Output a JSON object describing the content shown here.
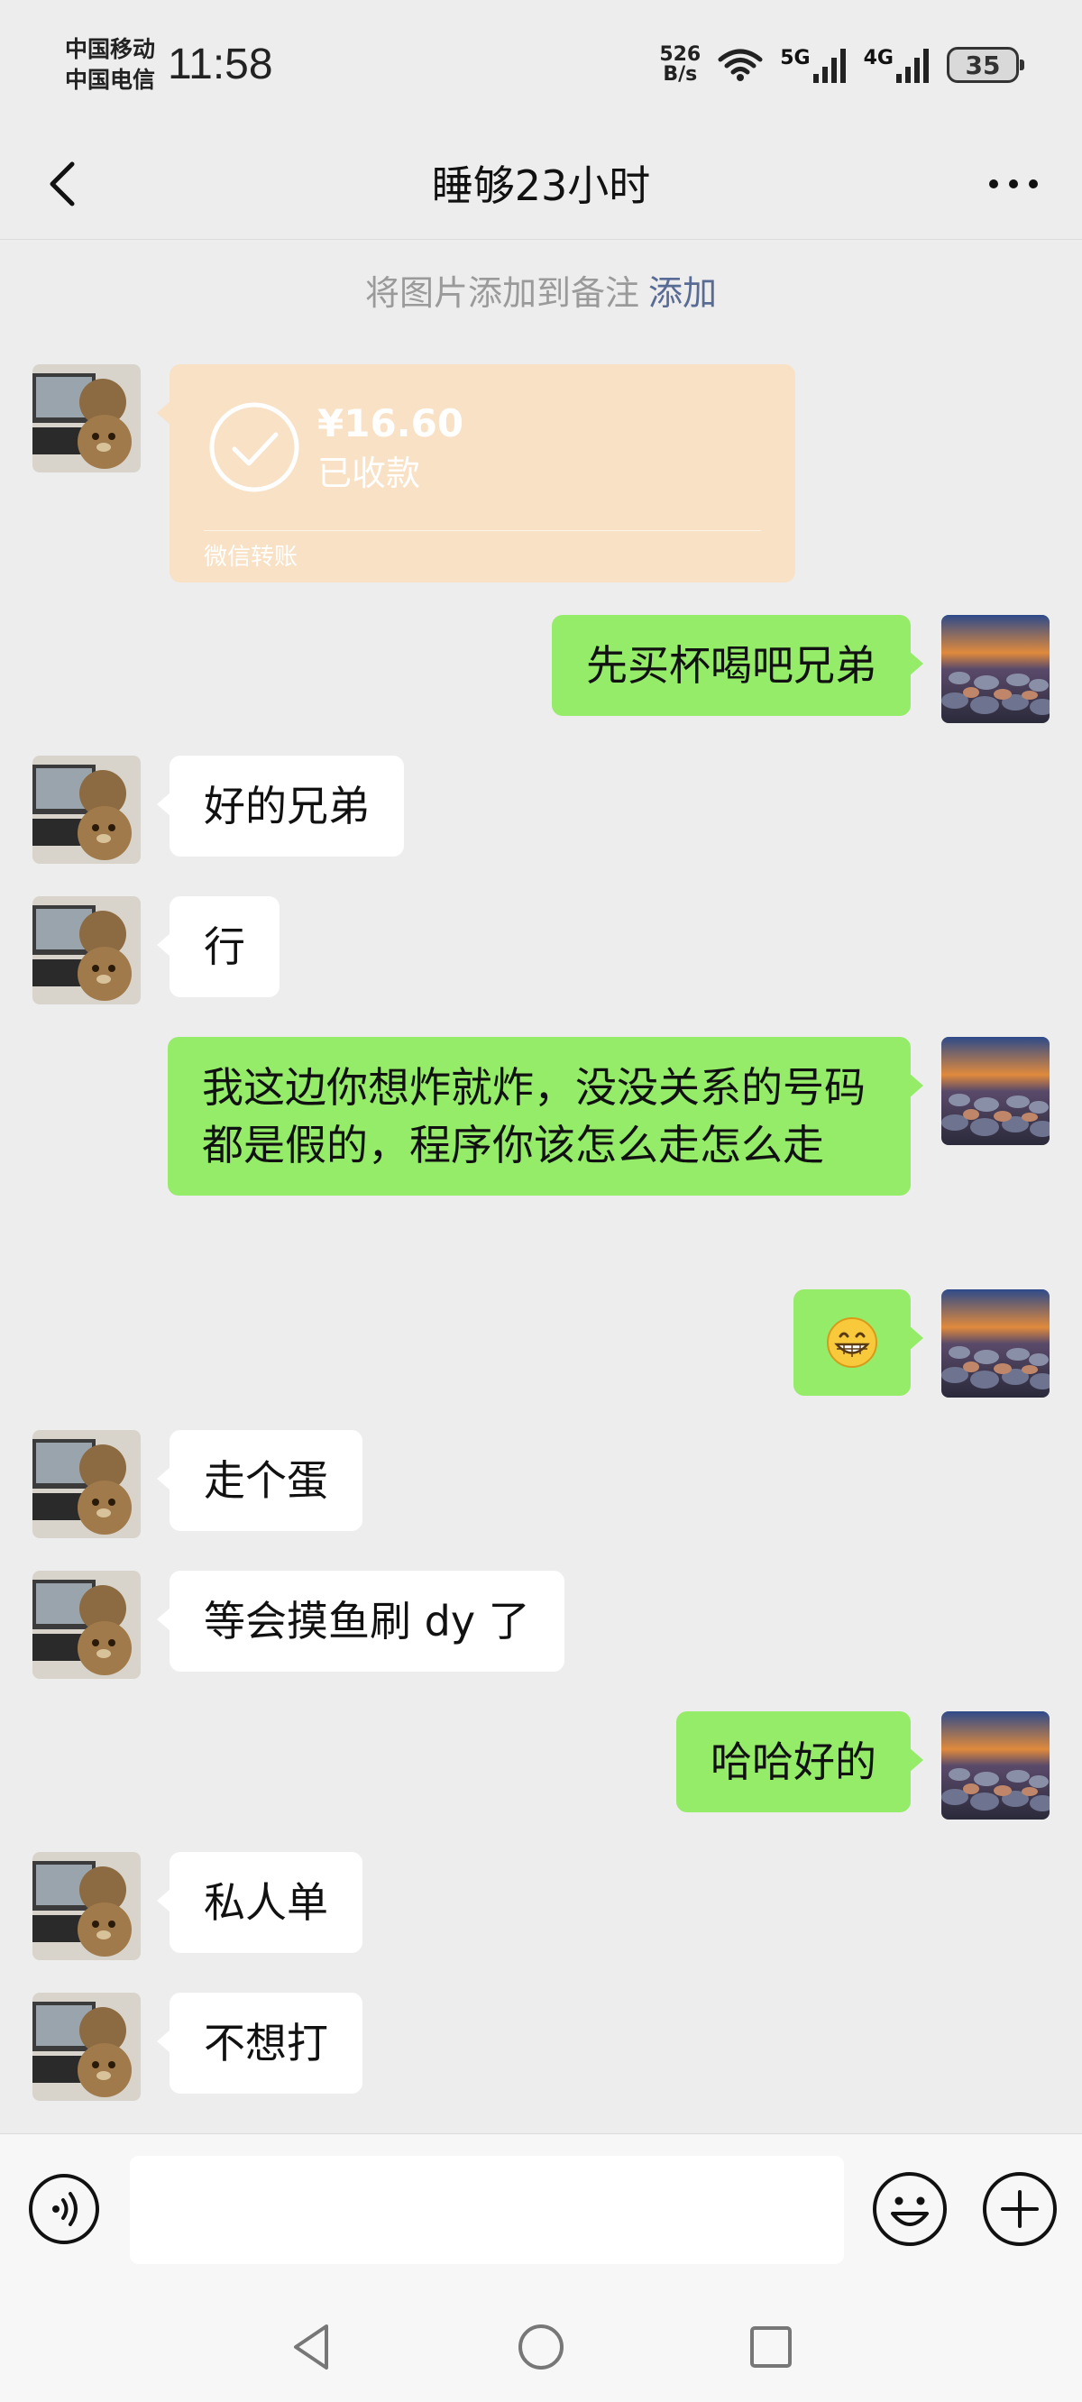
{
  "status_bar": {
    "carrier_1": "中国移动",
    "carrier_2": "中国电信",
    "time": "11:58",
    "net_speed_value": "526",
    "net_speed_unit": "B/s",
    "signal_1": "5G",
    "signal_2": "4G",
    "battery": "35"
  },
  "nav": {
    "title": "睡够23小时",
    "back_icon": "chevron-left-icon",
    "more_icon": "more-dots-icon"
  },
  "notice": {
    "text": "将图片添加到备注",
    "link": "添加"
  },
  "transfer": {
    "amount": "¥16.60",
    "status": "已收款",
    "label": "微信转账"
  },
  "messages": [
    {
      "side": "right",
      "text": "先买杯喝吧兄弟"
    },
    {
      "side": "left",
      "text": "好的兄弟"
    },
    {
      "side": "left",
      "text": "行"
    },
    {
      "side": "right",
      "text": "我这边你想炸就炸，没没关系的号码都是假的，程序你该怎么走怎么走"
    },
    {
      "side": "right",
      "text": "",
      "emoji": "grin-emoji"
    },
    {
      "side": "left",
      "text": "走个蛋"
    },
    {
      "side": "left",
      "text": "等会摸鱼刷 dy 了"
    },
    {
      "side": "right",
      "text": "哈哈好的"
    },
    {
      "side": "left",
      "text": "私人单"
    },
    {
      "side": "left",
      "text": "不想打"
    }
  ],
  "input_bar": {
    "placeholder": "",
    "voice_icon": "voice-icon",
    "emoji_icon": "emoji-icon",
    "plus_icon": "plus-icon"
  },
  "colors": {
    "background": "#ededed",
    "bubble_self": "#95ec69",
    "bubble_other": "#ffffff",
    "transfer_card": "#f8e1c5",
    "link": "#576b95"
  }
}
